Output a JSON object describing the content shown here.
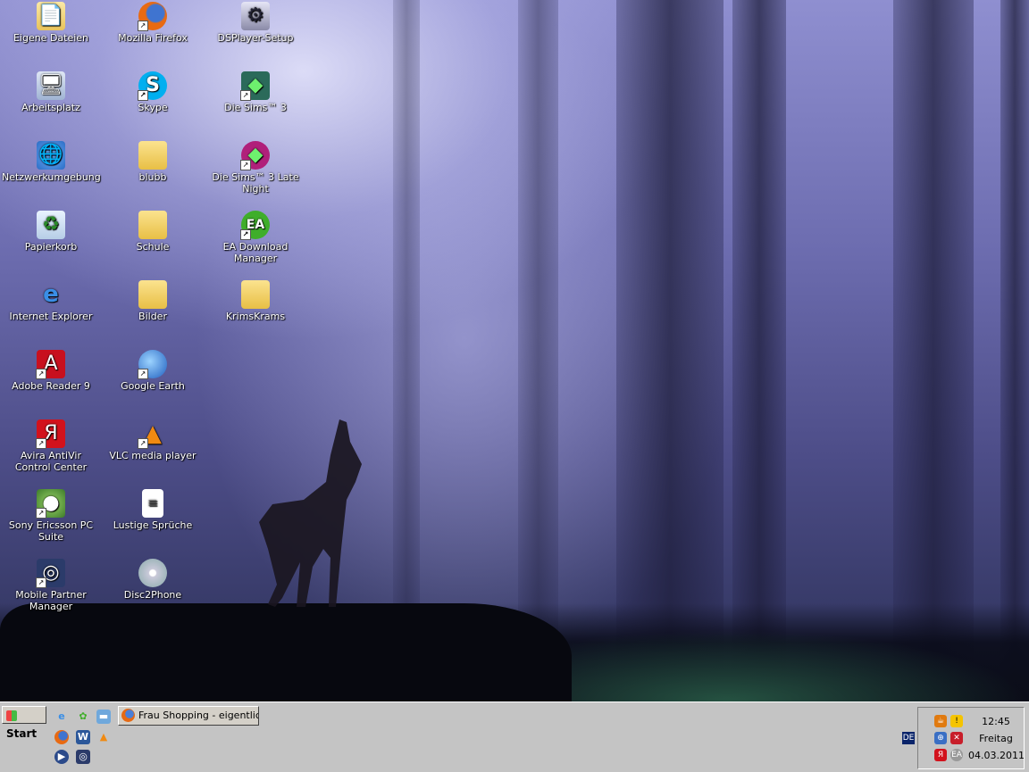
{
  "desktop": {
    "icons": [
      {
        "label": "Eigene Dateien",
        "icon": "folder-documents-icon",
        "shortcut": false
      },
      {
        "label": "Arbeitsplatz",
        "icon": "computer-icon",
        "shortcut": false
      },
      {
        "label": "Netzwerkumgebung",
        "icon": "network-icon",
        "shortcut": false
      },
      {
        "label": "Papierkorb",
        "icon": "recycle-bin-icon",
        "shortcut": false
      },
      {
        "label": "Internet Explorer",
        "icon": "internet-explorer-icon",
        "shortcut": false
      },
      {
        "label": "Adobe Reader 9",
        "icon": "adobe-reader-icon",
        "shortcut": true
      },
      {
        "label": "Avira AntiVir Control Center",
        "icon": "avira-icon",
        "shortcut": true
      },
      {
        "label": "Sony Ericsson PC Suite",
        "icon": "sony-ericsson-icon",
        "shortcut": true
      },
      {
        "label": "Mobile Partner Manager",
        "icon": "mobile-partner-icon",
        "shortcut": true
      },
      {
        "label": "Mozilla Firefox",
        "icon": "firefox-icon",
        "shortcut": true
      },
      {
        "label": "Skype",
        "icon": "skype-icon",
        "shortcut": true
      },
      {
        "label": "blubb",
        "icon": "folder-icon",
        "shortcut": false
      },
      {
        "label": "Schule",
        "icon": "folder-icon",
        "shortcut": false
      },
      {
        "label": "Bilder",
        "icon": "folder-icon",
        "shortcut": false
      },
      {
        "label": "Google Earth",
        "icon": "google-earth-icon",
        "shortcut": true
      },
      {
        "label": "VLC media player",
        "icon": "vlc-icon",
        "shortcut": true
      },
      {
        "label": "Lustige Sprüche",
        "icon": "text-document-icon",
        "shortcut": false
      },
      {
        "label": "Disc2Phone",
        "icon": "disc2phone-icon",
        "shortcut": false
      },
      {
        "label": "DSPlayer-Setup",
        "icon": "setup-icon",
        "shortcut": false
      },
      {
        "label": "Die Sims™ 3",
        "icon": "sims3-icon",
        "shortcut": true
      },
      {
        "label": "Die Sims™ 3 Late Night",
        "icon": "sims3-late-night-icon",
        "shortcut": true
      },
      {
        "label": "EA Download Manager",
        "icon": "ea-icon",
        "shortcut": true
      },
      {
        "label": "KrimsKrams",
        "icon": "folder-icon",
        "shortcut": false
      }
    ]
  },
  "taskbar": {
    "start_label": "Start",
    "quick_launch": [
      "internet-explorer-icon",
      "icq-icon",
      "show-desktop-icon",
      "firefox-icon",
      "word-icon",
      "vlc-icon",
      "media-player-icon",
      "network-globe-icon"
    ],
    "task_buttons": [
      {
        "label": "Frau Shopping - eigentlic...",
        "icon": "firefox-icon"
      }
    ],
    "language": "DE",
    "tray_expand": "«",
    "clock": {
      "time": "12:45",
      "day": "Freitag",
      "date": "04.03.2011"
    }
  },
  "colors": {
    "taskbar": "#c4c4c4",
    "folder": "#f2d36b",
    "desktop_sky": "#8f8fd0"
  }
}
